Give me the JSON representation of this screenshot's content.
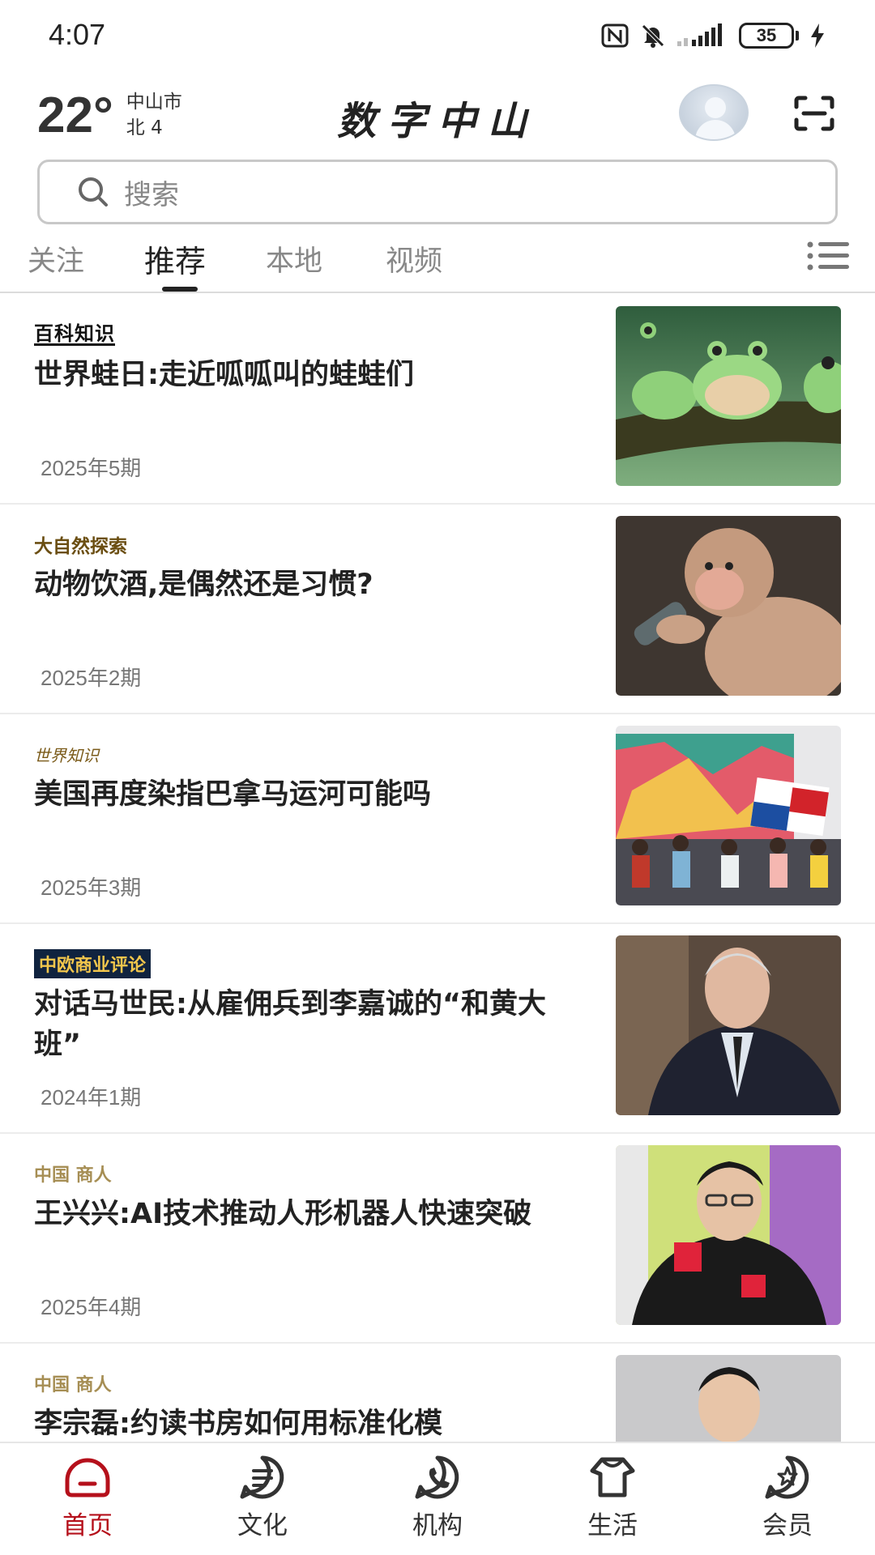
{
  "status_bar": {
    "time": "4:07",
    "battery": "35"
  },
  "header": {
    "temperature": "22°",
    "city": "中山市",
    "wind": "北 4",
    "app_title": "数字中山"
  },
  "search": {
    "placeholder": "搜索"
  },
  "tabs": [
    {
      "label": "关注"
    },
    {
      "label": "推荐"
    },
    {
      "label": "本地"
    },
    {
      "label": "视频"
    }
  ],
  "active_tab": "推荐",
  "articles": [
    {
      "source": "百科知识",
      "title": "世界蛙日:走近呱呱叫的蛙蛙们",
      "issue": "2025年5期",
      "image": "frogs-photo"
    },
    {
      "source": "大自然探索",
      "title": "动物饮酒,是偶然还是习惯?",
      "issue": "2025年2期",
      "image": "monkey-photo"
    },
    {
      "source": "世界知识",
      "title": "美国再度染指巴拿马运河可能吗",
      "issue": "2025年3期",
      "image": "panama-protest-photo"
    },
    {
      "source": "中欧商业评论",
      "title": "对话马世民:从雇佣兵到李嘉诚的“和黄大班”",
      "issue": "2024年1期",
      "image": "man-portrait-photo"
    },
    {
      "source": "中国 商人",
      "title": "王兴兴:AI技术推动人形机器人快速突破",
      "issue": "2025年4期",
      "image": "speaker-photo"
    },
    {
      "source": "中国 商人",
      "title": "李宗磊:约读书房如何用标准化模",
      "issue": "",
      "image": "man-suit-photo"
    }
  ],
  "bottom_nav": [
    {
      "label": "首页",
      "icon": "home-icon",
      "active": true
    },
    {
      "label": "文化",
      "icon": "culture-icon",
      "active": false
    },
    {
      "label": "机构",
      "icon": "phone-icon",
      "active": false
    },
    {
      "label": "生活",
      "icon": "life-icon",
      "active": false
    },
    {
      "label": "会员",
      "icon": "member-icon",
      "active": false
    }
  ],
  "colors": {
    "accent": "#b5101b",
    "text": "#222222",
    "muted": "#888888"
  }
}
